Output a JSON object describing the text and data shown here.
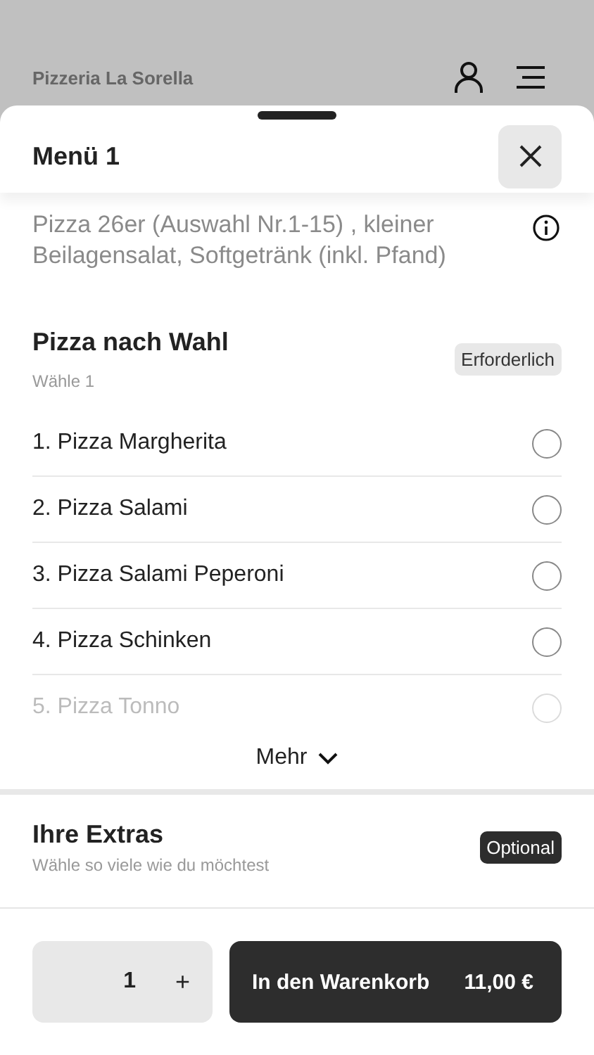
{
  "app_bar": {
    "title": "Pizzeria La Sorella"
  },
  "sheet": {
    "title": "Menü 1",
    "description": "Pizza 26er (Auswahl Nr.1-15) , kleiner Beilagensalat, Softgetränk (inkl. Pfand)"
  },
  "groups": [
    {
      "title": "Pizza nach Wahl",
      "subtitle": "Wähle 1",
      "badge": "Erforderlich",
      "badge_filled": false,
      "options": [
        {
          "label": "1. Pizza Margherita",
          "selected": false,
          "faded": false
        },
        {
          "label": "2. Pizza Salami",
          "selected": false,
          "faded": false
        },
        {
          "label": "3. Pizza Salami Peperoni",
          "selected": false,
          "faded": false
        },
        {
          "label": "4. Pizza Schinken",
          "selected": false,
          "faded": false
        },
        {
          "label": "5. Pizza Tonno",
          "selected": false,
          "faded": true
        }
      ],
      "more": "Mehr"
    },
    {
      "title": "Ihre Extras",
      "subtitle": "Wähle so viele wie du möchtest",
      "badge": "Optional",
      "badge_filled": true
    }
  ],
  "footer": {
    "quantity": "1",
    "increment": "+",
    "cart_label": "In den Warenkorb",
    "price": "11,00 €"
  }
}
